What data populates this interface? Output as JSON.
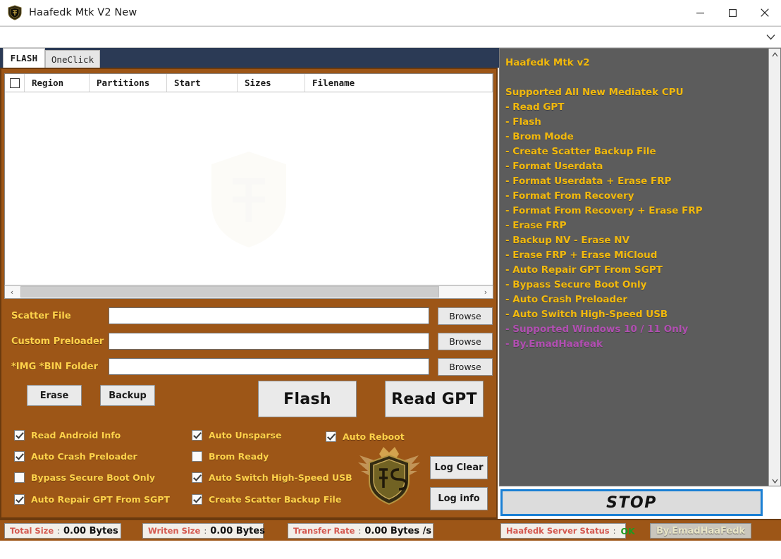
{
  "window": {
    "title": "Haafedk Mtk V2 New",
    "icon": "shield-logo-icon",
    "minimize_label": "–",
    "maximize_label": "□",
    "close_label": "✕"
  },
  "combobox": {
    "value": "",
    "arrow": "chevron-down-icon"
  },
  "tabs": [
    {
      "label": "FLASH",
      "active": true
    },
    {
      "label": "OneClick",
      "active": false
    }
  ],
  "table": {
    "columns": [
      "Region",
      "Partitions",
      "Start",
      "Sizes",
      "Filename"
    ],
    "select_all_checked": false,
    "rows": []
  },
  "scrollbar": {
    "left_arrow": "‹",
    "right_arrow": "›"
  },
  "file_fields": [
    {
      "label": "Scatter File",
      "value": "",
      "button": "Browse"
    },
    {
      "label": "Custom Preloader",
      "value": "",
      "button": "Browse"
    },
    {
      "label": "*IMG *BIN Folder",
      "value": "",
      "button": "Browse"
    }
  ],
  "actions": {
    "erase": "Erase",
    "backup": "Backup",
    "flash": "Flash",
    "read_gpt": "Read GPT"
  },
  "options": [
    {
      "label": "Read Android Info",
      "checked": true,
      "col": 0,
      "row": 0
    },
    {
      "label": "Auto Crash Preloader",
      "checked": true,
      "col": 0,
      "row": 1
    },
    {
      "label": "Bypass Secure Boot Only",
      "checked": false,
      "col": 0,
      "row": 2
    },
    {
      "label": "Auto Repair GPT From SGPT",
      "checked": true,
      "col": 0,
      "row": 3
    },
    {
      "label": "Auto Unsparse",
      "checked": true,
      "col": 1,
      "row": 0
    },
    {
      "label": "Brom Ready",
      "checked": false,
      "col": 1,
      "row": 1
    },
    {
      "label": "Auto Switch High-Speed USB",
      "checked": true,
      "col": 1,
      "row": 2
    },
    {
      "label": "Create Scatter Backup File",
      "checked": true,
      "col": 1,
      "row": 3
    },
    {
      "label": "Auto Reboot",
      "checked": true,
      "col": 2,
      "row": 0
    }
  ],
  "log_buttons": {
    "clear": "Log Clear",
    "info": "Log info"
  },
  "log_panel": {
    "lines": [
      {
        "text": "Haafedk Mtk v2",
        "style": "gold"
      },
      {
        "text": "",
        "style": "blank"
      },
      {
        "text": "Supported All New Mediatek CPU",
        "style": "gold"
      },
      {
        "text": "- Read GPT",
        "style": "gold"
      },
      {
        "text": "- Flash",
        "style": "gold"
      },
      {
        "text": "- Brom Mode",
        "style": "gold"
      },
      {
        "text": "- Create Scatter Backup File",
        "style": "gold"
      },
      {
        "text": "- Format Userdata",
        "style": "gold"
      },
      {
        "text": "- Format Userdata + Erase FRP",
        "style": "gold"
      },
      {
        "text": "- Format From Recovery",
        "style": "gold"
      },
      {
        "text": "- Format From Recovery + Erase FRP",
        "style": "gold"
      },
      {
        "text": "- Erase FRP",
        "style": "gold"
      },
      {
        "text": "- Backup NV - Erase NV",
        "style": "gold"
      },
      {
        "text": "- Erase FRP + Erase MiCloud",
        "style": "gold"
      },
      {
        "text": "- Auto Repair GPT From SGPT",
        "style": "gold"
      },
      {
        "text": "- Bypass Secure Boot Only",
        "style": "gold"
      },
      {
        "text": "- Auto Crash Preloader",
        "style": "gold"
      },
      {
        "text": "- Auto Switch High-Speed USB",
        "style": "gold"
      },
      {
        "text": "- Supported Windows 10 / 11 Only",
        "style": "purple"
      },
      {
        "text": "- By.EmadHaafeak",
        "style": "purple"
      }
    ]
  },
  "stop_button": {
    "label": "STOP"
  },
  "status": {
    "total_size": {
      "key": "Total Size",
      "sep": ":",
      "value": "0.00 Bytes"
    },
    "written_size": {
      "key": "Writen Size",
      "sep": ":",
      "value": "0.00 Bytes"
    },
    "transfer_rate": {
      "key": "Transfer Rate",
      "sep": ":",
      "value": "0.00 Bytes /s"
    },
    "server_status": {
      "key": "Haafedk Server Status",
      "sep": ":",
      "value": "OK"
    },
    "credit": "By.EmadHaaFedk"
  },
  "colors": {
    "panel_orange": "#9d5617",
    "panel_border": "#6b3a0e",
    "gold_text": "#ffd24a",
    "log_gold": "#f2b90d",
    "log_purple": "#b14fb1",
    "tabstrip_navy": "#2b3a55",
    "right_gray": "#5c5c5c",
    "focus_blue": "#1a7fd4",
    "status_key_red": "#d4584f",
    "status_ok_green": "#1f9b1f"
  }
}
